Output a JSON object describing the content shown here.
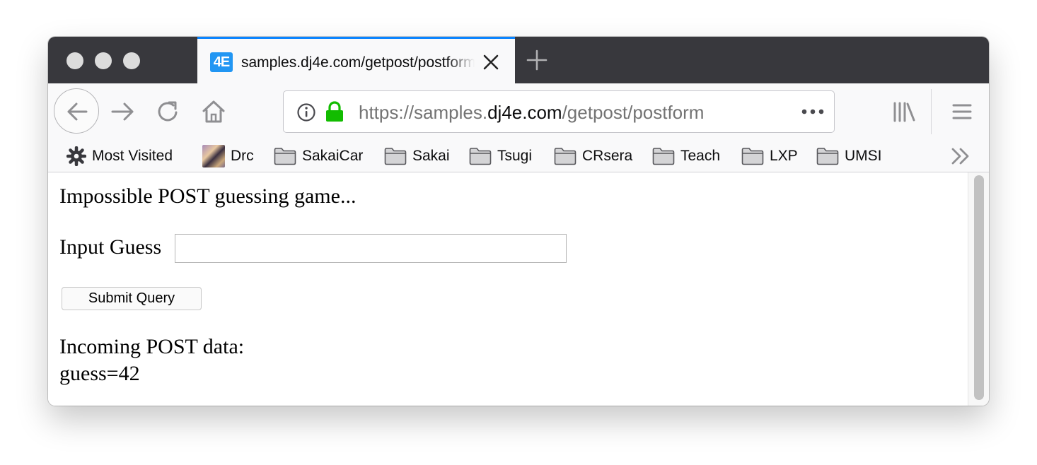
{
  "browser": {
    "tab": {
      "favicon_text": "4E",
      "title": "samples.dj4e.com/getpost/postform",
      "accent_color": "#0a84ff"
    },
    "url": {
      "scheme": "https://samples.",
      "host": "dj4e.com",
      "path": "/getpost/postform"
    },
    "icons": {
      "back": "back-arrow-icon",
      "forward": "forward-arrow-icon",
      "reload": "reload-icon",
      "home": "home-icon",
      "info": "info-icon",
      "lock": "lock-icon",
      "page_actions": "more-dots-icon",
      "library": "library-icon",
      "menu": "hamburger-menu-icon"
    },
    "bookmarks": [
      {
        "label": "Most Visited",
        "icon": "gear-icon"
      },
      {
        "label": "Drc",
        "icon": "avatar-icon"
      },
      {
        "label": "SakaiCar",
        "icon": "folder-icon"
      },
      {
        "label": "Sakai",
        "icon": "folder-icon"
      },
      {
        "label": "Tsugi",
        "icon": "folder-icon"
      },
      {
        "label": "CRsera",
        "icon": "folder-icon"
      },
      {
        "label": "Teach",
        "icon": "folder-icon"
      },
      {
        "label": "LXP",
        "icon": "folder-icon"
      },
      {
        "label": "UMSI",
        "icon": "folder-icon"
      }
    ]
  },
  "page": {
    "heading": "Impossible POST guessing game...",
    "guess_label": "Input Guess",
    "guess_value": "",
    "submit_label": "Submit Query",
    "incoming_label": "Incoming POST data:",
    "incoming_value": "guess=42"
  }
}
